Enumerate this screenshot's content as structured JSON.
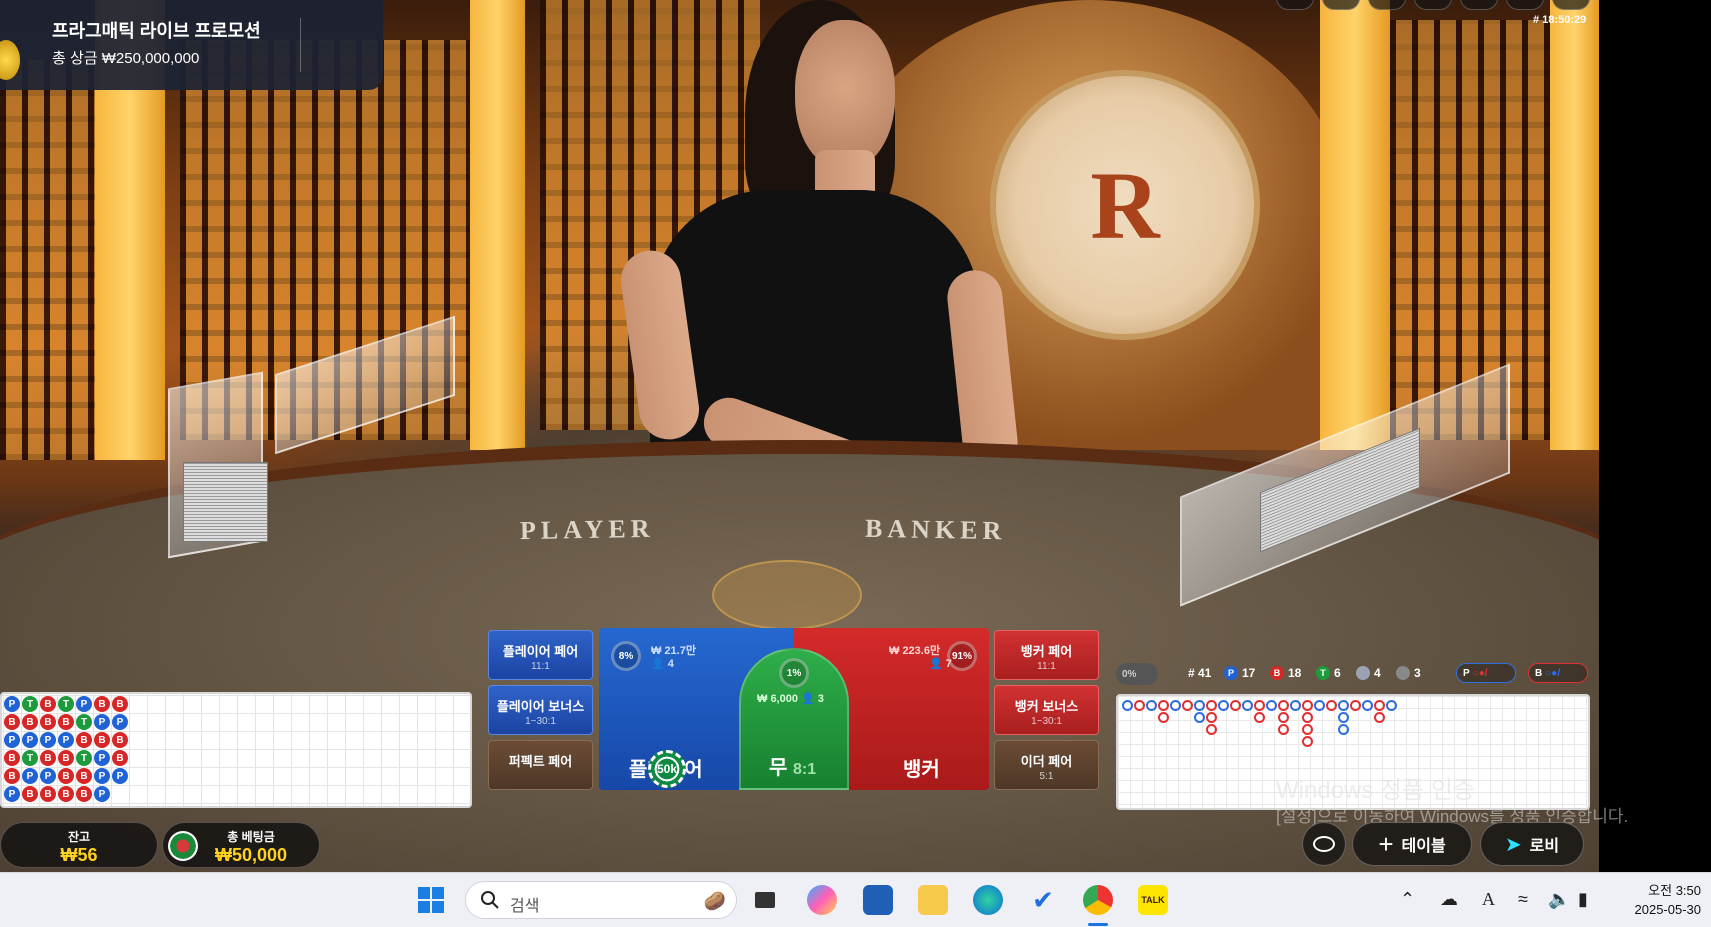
{
  "promo": {
    "title": "프라그매틱 라이브 프로모션",
    "prize": "총 상금 ₩250,000,000"
  },
  "timestamp": "# 18:50:29",
  "table": {
    "felt_player": "PLAYER",
    "felt_banker": "BANKER",
    "medallion_letter": "R"
  },
  "bead_road": [
    [
      "P",
      "B",
      "P",
      "B",
      "B",
      "P"
    ],
    [
      "T",
      "B",
      "P",
      "T",
      "P",
      "B"
    ],
    [
      "B",
      "B",
      "P",
      "B",
      "P",
      "B"
    ],
    [
      "T",
      "B",
      "P",
      "B",
      "B",
      "B"
    ],
    [
      "P",
      "T",
      "B",
      "T",
      "B",
      "B"
    ],
    [
      "B",
      "P",
      "B",
      "P",
      "P",
      "P"
    ],
    [
      "B",
      "P",
      "B",
      "B",
      "P",
      ""
    ]
  ],
  "balance": {
    "label": "잔고",
    "value": "₩56"
  },
  "total_bet": {
    "label": "총 베팅금",
    "value": "₩50,000"
  },
  "bets": {
    "player_pair": {
      "label": "플레이어 페어",
      "odds": "11:1"
    },
    "player_bonus": {
      "label": "플레이어 보너스",
      "odds": "1~30:1"
    },
    "perfect_pair": {
      "label": "퍼펙트 페어",
      "odds": ""
    },
    "banker_pair": {
      "label": "뱅커 페어",
      "odds": "11:1"
    },
    "banker_bonus": {
      "label": "뱅커 보너스",
      "odds": "1~30:1"
    },
    "either_pair": {
      "label": "이더 페어",
      "odds": "5:1"
    },
    "player": {
      "label": "플레이어",
      "percent": "8%",
      "amount": "₩ 21.7만",
      "players": "4"
    },
    "tie": {
      "label": "무",
      "odds": "8:1",
      "percent": "1%",
      "amount": "₩ 6,000",
      "players": "3"
    },
    "banker": {
      "label": "뱅커",
      "percent": "91%",
      "amount": "₩ 223.6만",
      "players": "7"
    }
  },
  "placed_chip": "50k",
  "roads_header": {
    "toggle": "0%",
    "rounds": "# 41",
    "player_count": "17",
    "banker_count": "18",
    "tie_count": "6",
    "player_pair_count": "4",
    "banker_pair_count": "3",
    "player_predict": "P",
    "banker_predict": "B"
  },
  "watermark": {
    "line1": "Windows 정품 인증",
    "line2": "[설정]으로 이동하여 Windows를 정품 인증합니다."
  },
  "controls": {
    "table_button": "테이블",
    "lobby_button": "로비"
  },
  "taskbar": {
    "search_placeholder": "검색",
    "time": "오전 3:50",
    "date": "2025-05-30"
  },
  "colors": {
    "player": "#1f63d6",
    "banker": "#d62626",
    "tie": "#1d9a3c",
    "gold": "#ffd21f"
  }
}
